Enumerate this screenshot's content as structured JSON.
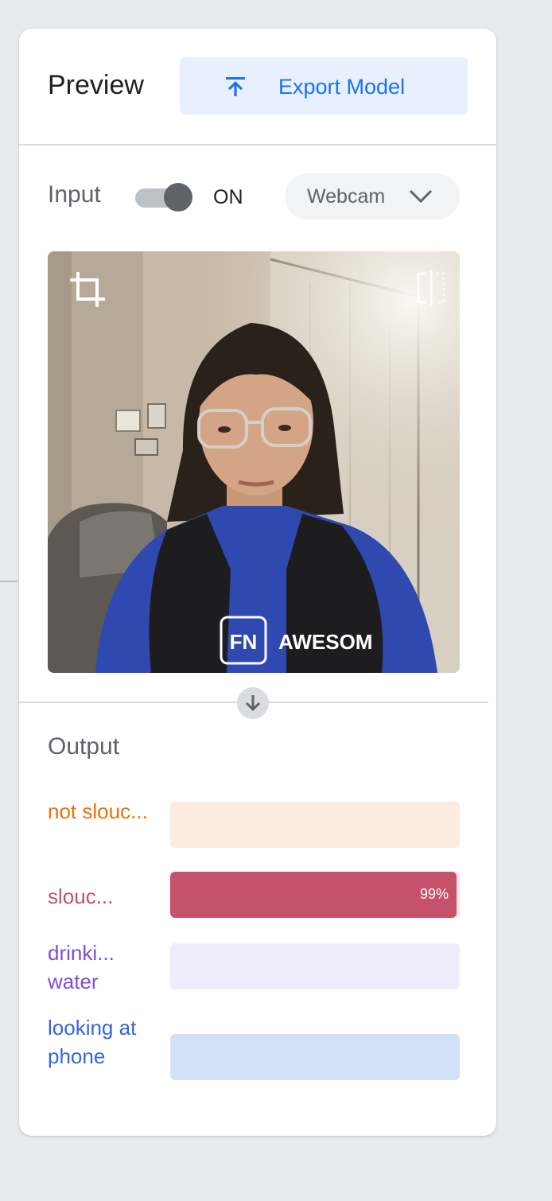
{
  "header": {
    "title": "Preview",
    "export_label": "Export Model"
  },
  "input": {
    "label": "Input",
    "toggle_state": "ON",
    "toggle_on": true,
    "source": "Webcam"
  },
  "webcam": {
    "shirt_text_badge": "FN",
    "shirt_text": "AWESOM"
  },
  "output": {
    "title": "Output",
    "classes": [
      {
        "label": "not slouc...",
        "color": "#e8710a",
        "track": "#fcebe0",
        "value": 0,
        "value_label": ""
      },
      {
        "label": "slouc...",
        "color": "#c5526a",
        "track": "#fbe4e8",
        "value": 0.99,
        "value_label": "99%"
      },
      {
        "label": "drinki... water",
        "color": "#7b4fd8",
        "track": "#efedfc",
        "value": 0,
        "value_label": ""
      },
      {
        "label": "looking at phone",
        "color": "#3367d6",
        "track": "#d3e1f7",
        "value": 0,
        "value_label": ""
      }
    ]
  },
  "colors": {
    "accent": "#1a73e8",
    "export_bg": "#e8f0fe"
  },
  "icons": {
    "export": "upload-arrow-icon",
    "crop": "crop-icon",
    "flip": "flip-horizontal-icon",
    "dropdown": "chevron-down-icon",
    "flow": "arrow-down-icon"
  }
}
